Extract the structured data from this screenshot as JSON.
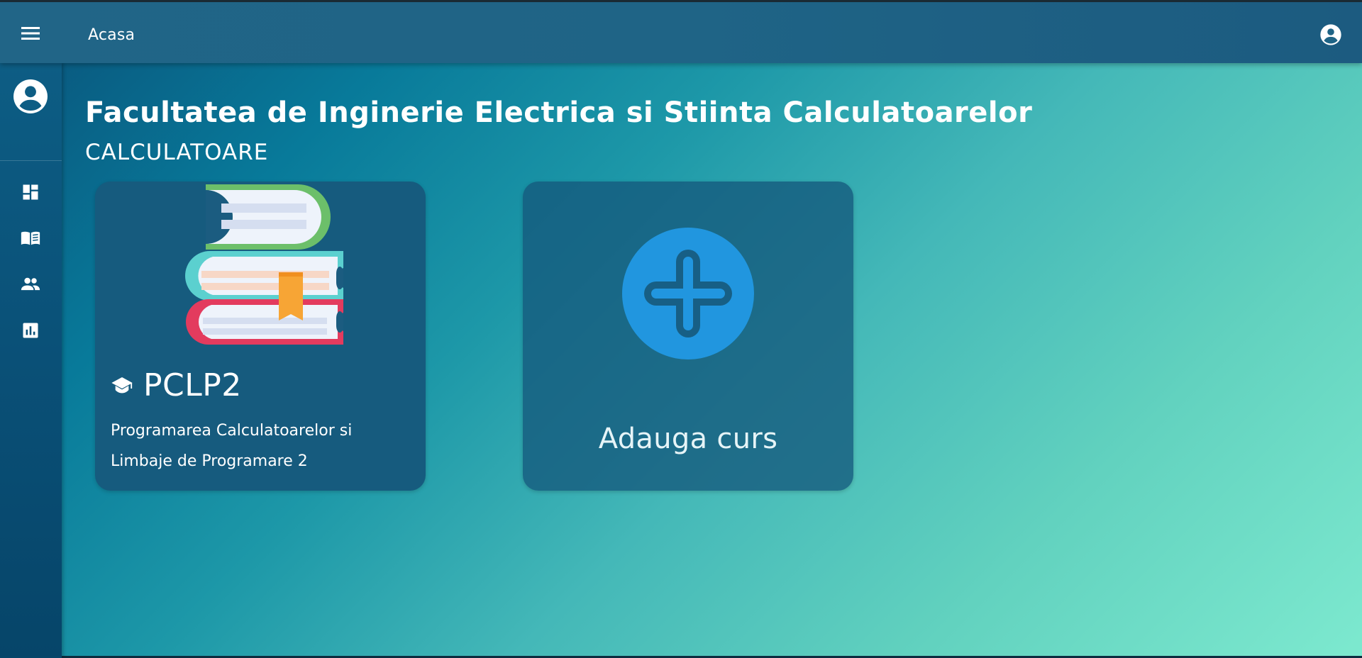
{
  "header": {
    "title": "Acasa",
    "menu_icon": "menu-icon",
    "account_icon": "account-circle-icon"
  },
  "sidebar": {
    "avatar_icon": "account-circle-icon",
    "items": [
      {
        "icon": "dashboard-icon"
      },
      {
        "icon": "menu-book-icon"
      },
      {
        "icon": "people-icon"
      },
      {
        "icon": "bar-chart-icon"
      }
    ]
  },
  "main": {
    "faculty_title": "Facultatea de Inginerie Electrica si Stiinta Calculatoarelor",
    "department": "CALCULATOARE",
    "courses": [
      {
        "code": "PCLP2",
        "name_line1": "Programarea Calculatoarelor si",
        "name_line2": "Limbaje de Programare 2",
        "icon": "school-icon"
      }
    ],
    "add_course_label": "Adauga curs"
  },
  "colors": {
    "topbar": "#1f6486",
    "sidebar": "#0a5077",
    "card": "#165b7e",
    "plus_circle": "#2196df",
    "plus_stroke": "#175f85",
    "gradient_start": "#0a5078",
    "gradient_end": "#7de9cf"
  }
}
